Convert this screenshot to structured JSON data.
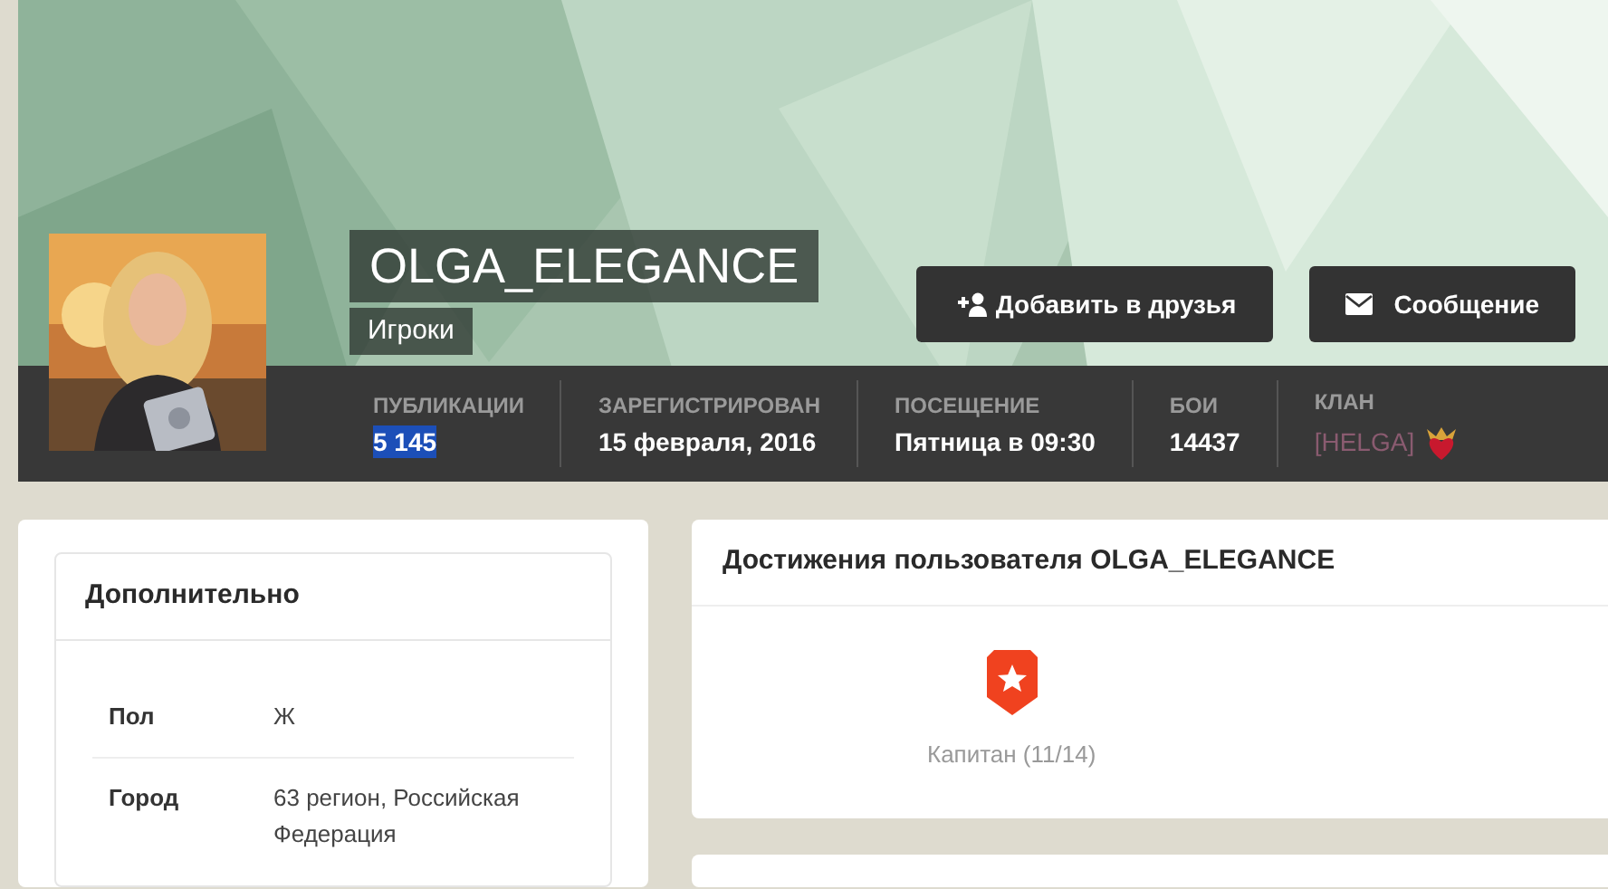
{
  "profile": {
    "name": "OLGA_ELEGANCE",
    "group": "Игроки"
  },
  "actions": [
    {
      "kind": "add-friend",
      "label": "Добавить в друзья"
    },
    {
      "kind": "message",
      "label": "Сообщение"
    }
  ],
  "stats": [
    {
      "label": "ПУБЛИКАЦИИ",
      "value": "5 145",
      "highlighted": true
    },
    {
      "label": "ЗАРЕГИСТРИРОВАН",
      "value": "15 февраля, 2016",
      "highlighted": false
    },
    {
      "label": "ПОСЕЩЕНИЕ",
      "value": "Пятница в 09:30",
      "highlighted": false
    },
    {
      "label": "БОИ",
      "value": "14437",
      "highlighted": false
    },
    {
      "label": "КЛАН",
      "value": "[HELGA]",
      "highlighted": false,
      "kind": "clan"
    }
  ],
  "extra": {
    "title": "Дополнительно",
    "fields": [
      {
        "label": "Пол",
        "value": "Ж"
      },
      {
        "label": "Город",
        "value": "63 регион, Российская Федерация"
      }
    ]
  },
  "achievements": {
    "title": "Достижения пользователя OLGA_ELEGANCE",
    "items": [
      {
        "label": "Капитан (11/14)"
      }
    ]
  }
}
